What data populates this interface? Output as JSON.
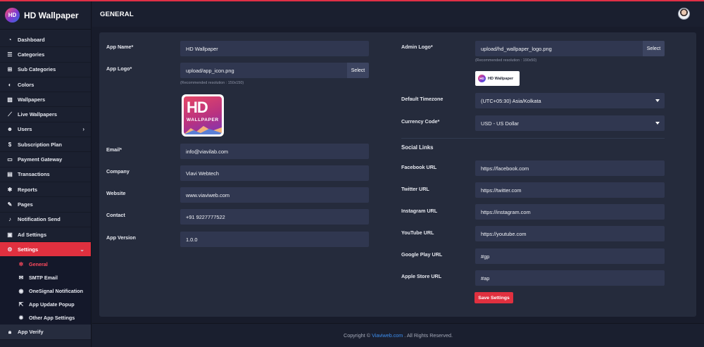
{
  "app": {
    "brand": "HD Wallpaper",
    "brand_badge": "HD"
  },
  "header": {
    "title": "GENERAL"
  },
  "sidebar": {
    "items": [
      {
        "label": "Dashboard",
        "icon": "dashboard-icon",
        "glyph": "◔"
      },
      {
        "label": "Categories",
        "icon": "list-icon",
        "glyph": "☰"
      },
      {
        "label": "Sub Categories",
        "icon": "sitemap-icon",
        "glyph": "⊞"
      },
      {
        "label": "Colors",
        "icon": "palette-icon",
        "glyph": "◐"
      },
      {
        "label": "Wallpapers",
        "icon": "image-icon",
        "glyph": "▨"
      },
      {
        "label": "Live Wallpapers",
        "icon": "magic-wand-icon",
        "glyph": "⟋"
      },
      {
        "label": "Users",
        "icon": "users-icon",
        "glyph": "☻",
        "caret": "›"
      },
      {
        "label": "Subscription Plan",
        "icon": "dollar-icon",
        "glyph": "$"
      },
      {
        "label": "Payment Gateway",
        "icon": "credit-card-icon",
        "glyph": "▭"
      },
      {
        "label": "Transactions",
        "icon": "receipt-icon",
        "glyph": "▤"
      },
      {
        "label": "Reports",
        "icon": "bug-icon",
        "glyph": "✱"
      },
      {
        "label": "Pages",
        "icon": "edit-icon",
        "glyph": "✎"
      },
      {
        "label": "Notification Send",
        "icon": "bell-icon",
        "glyph": "♪"
      },
      {
        "label": "Ad Settings",
        "icon": "ad-icon",
        "glyph": "▣"
      }
    ],
    "settings": {
      "label": "Settings",
      "icon": "gear-icon",
      "glyph": "⚙",
      "caret": "⌄"
    },
    "sub_items": [
      {
        "label": "General",
        "icon": "gear-small-icon",
        "glyph": "✲",
        "current": true
      },
      {
        "label": "SMTP Email",
        "icon": "envelope-icon",
        "glyph": "✉"
      },
      {
        "label": "OneSignal Notification",
        "icon": "signal-icon",
        "glyph": "◉"
      },
      {
        "label": "App Update Popup",
        "icon": "external-link-icon",
        "glyph": "⇱"
      },
      {
        "label": "Other App Settings",
        "icon": "cog-icon",
        "glyph": "✹"
      }
    ],
    "app_verify": {
      "label": "App Verify",
      "icon": "lock-icon",
      "glyph": "🔒︎"
    }
  },
  "left_form": {
    "app_name": {
      "label": "App Name*",
      "value": "HD Wallpaper"
    },
    "app_logo": {
      "label": "App Logo*",
      "value": "upload/app_icon.png",
      "button": "Select",
      "hint": "(Recommended resolution : 150x150)"
    },
    "app_icon_preview": {
      "big": "HD",
      "small": "WALLPAPER"
    },
    "email": {
      "label": "Email*",
      "value": "info@viavilab.com"
    },
    "company": {
      "label": "Company",
      "value": "Viavi Webtech"
    },
    "website": {
      "label": "Website",
      "value": "www.viaviweb.com"
    },
    "contact": {
      "label": "Contact",
      "value": "+91 9227777522"
    },
    "app_version": {
      "label": "App Version",
      "value": "1.0.0"
    }
  },
  "right_form": {
    "admin_logo": {
      "label": "Admin Logo*",
      "value": "upload/hd_wallpaper_logo.png",
      "button": "Select",
      "hint": "(Recommended resolution : 190x50)"
    },
    "admin_logo_preview": {
      "badge": "HD",
      "text": "HD Wallpaper"
    },
    "timezone": {
      "label": "Default Timezone",
      "value": "(UTC+05:30) Asia/Kolkata"
    },
    "currency": {
      "label": "Currency Code*",
      "value": "USD - US Dollar"
    },
    "social_title": "Social Links",
    "facebook": {
      "label": "Facebook URL",
      "value": "https://facebook.com"
    },
    "twitter": {
      "label": "Twitter URL",
      "value": "https://twitter.com"
    },
    "instagram": {
      "label": "Instagram URL",
      "value": "https://instagram.com"
    },
    "youtube": {
      "label": "YouTube URL",
      "value": "https://youtube.com"
    },
    "google_play": {
      "label": "Google Play URL",
      "value": "#gp"
    },
    "apple_store": {
      "label": "Apple Store URL",
      "value": "#ap"
    },
    "save": "Save Settings"
  },
  "footer": {
    "prefix": "Copyright ©",
    "link": "Viaviweb.com",
    "suffix": ". All Rights Reserved."
  },
  "colors": {
    "accent": "#e0303f",
    "background": "#181c2b",
    "panel": "#252b3c",
    "field": "#303750",
    "link": "#3d8ff0"
  }
}
